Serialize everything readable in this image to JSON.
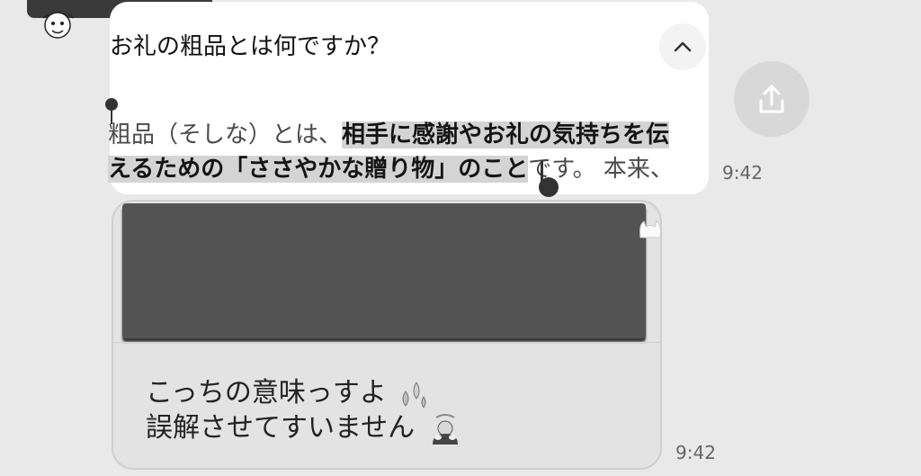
{
  "question": {
    "title": "お礼の粗品とは何ですか？"
  },
  "answer": {
    "line1_plain": "粗品（そしな）とは、",
    "line1_highlight": "相手に感謝やお礼の気持ちを伝",
    "line2_highlight": "えるための「ささやかな贈り物」のこと",
    "line2_plain": "です。 本来、"
  },
  "message": {
    "line1": "こっちの意味っすよ",
    "line1_emoji": "sweat-droplets-icon",
    "line2": "誤解させてすいません",
    "line2_emoji": "bowing-person-icon"
  },
  "timestamps": {
    "first": "9:42",
    "second": "9:42"
  },
  "icons": {
    "share": "share-icon",
    "collapse": "chevron-up-icon"
  },
  "colors": {
    "background": "#e9e9e9",
    "highlight": "#d4d4d4",
    "image_block": "#535353"
  }
}
